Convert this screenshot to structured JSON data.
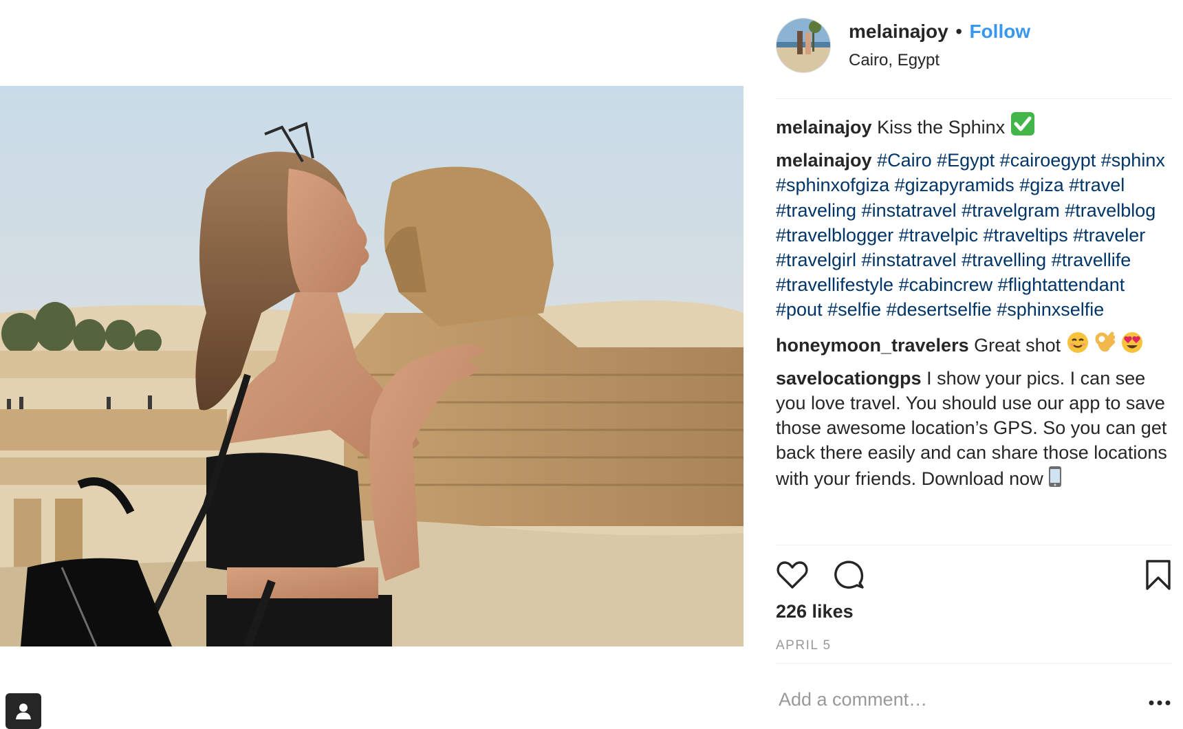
{
  "post": {
    "photo_alt": "woman kissing the Sphinx",
    "tag_icon": "user-tag-icon"
  },
  "header": {
    "username": "melainajoy",
    "separator": "•",
    "follow_label": "Follow",
    "location": "Cairo, Egypt",
    "avatar_icon": "avatar"
  },
  "comments": [
    {
      "user": "melainajoy",
      "text": "Kiss the Sphinx",
      "emoji": "check-mark-emoji"
    },
    {
      "user": "melainajoy",
      "hashtags": "#Cairo #Egypt #cairoegypt #sphinx #sphinxofgiza #gizapyramids #giza #travel #traveling #instatravel #travelgram #travelblog #travelblogger #travelpic #traveltips #traveler #travelgirl #instatravel #travelling #travellife #travellifestyle #cabincrew #flightattendant #pout #selfie #desertselfie #sphinxselfie"
    },
    {
      "user": "honeymoon_travelers",
      "text": "Great shot",
      "emojis": [
        "smiling-face-emoji",
        "ok-hand-emoji",
        "heart-eyes-emoji"
      ]
    },
    {
      "user": "savelocationgps",
      "text": "I show your pics. I can see you love travel. You should use our app to save those awesome location’s GPS. So you can get back there easily and can share those locations with your friends. Download now",
      "emoji": "mobile-phone-emoji"
    }
  ],
  "actions": {
    "like_icon": "heart-icon",
    "comment_icon": "comment-icon",
    "save_icon": "bookmark-icon"
  },
  "likes": "226 likes",
  "date": "APRIL 5",
  "add_comment": {
    "placeholder": "Add a comment…",
    "value": ""
  },
  "more_icon": "more-options-icon",
  "colors": {
    "follow": "#3897f0",
    "hashtag": "#003569",
    "text": "#262626",
    "muted": "#999999",
    "divider": "#efefef"
  }
}
